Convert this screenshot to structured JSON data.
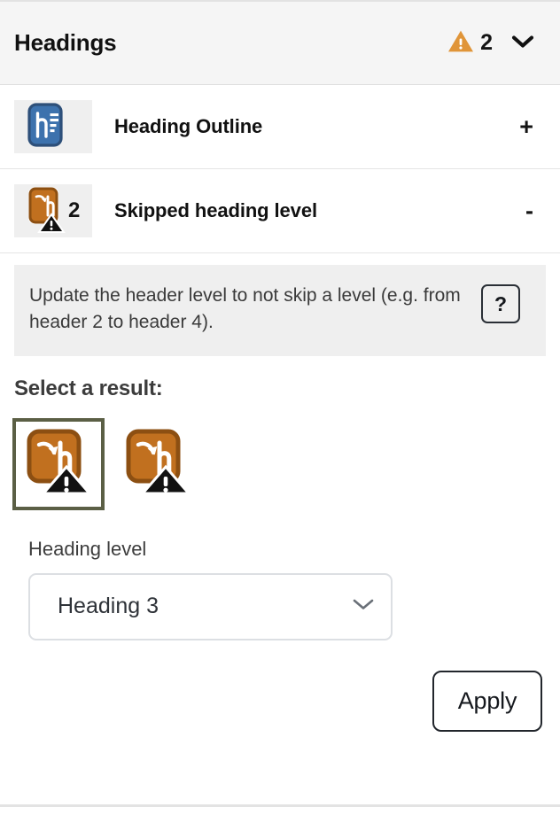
{
  "header": {
    "title": "Headings",
    "warning_icon": "warning-triangle-icon",
    "warning_count": "2",
    "collapse_icon": "chevron-down-icon"
  },
  "rows": [
    {
      "icon": "heading-outline-icon",
      "badge": "",
      "label": "Heading Outline",
      "toggle": "+",
      "expanded": false
    },
    {
      "icon": "skipped-heading-level-icon",
      "badge": "2",
      "label": "Skipped heading level",
      "toggle": "-",
      "expanded": true
    }
  ],
  "description": {
    "text": "Update the header level to not skip a level (e.g. from header 2 to header 4).",
    "help_label": "?",
    "help_icon": "question-mark-icon"
  },
  "result": {
    "section_title": "Select a result:",
    "options": [
      {
        "icon": "skipped-heading-level-icon",
        "selected": true
      },
      {
        "icon": "skipped-heading-level-icon",
        "selected": false
      }
    ]
  },
  "heading_level": {
    "label": "Heading level",
    "value": "Heading 3",
    "chevron_icon": "chevron-down-icon"
  },
  "actions": {
    "apply_label": "Apply"
  },
  "colors": {
    "header_bg": "#f5f5f5",
    "warning_orange": "#e09539",
    "icon_orange": "#c1701f",
    "icon_blue": "#3d72ad",
    "selection_border": "#5b5f45",
    "panel_bg": "#ffffff",
    "muted_bg": "#efefef"
  }
}
